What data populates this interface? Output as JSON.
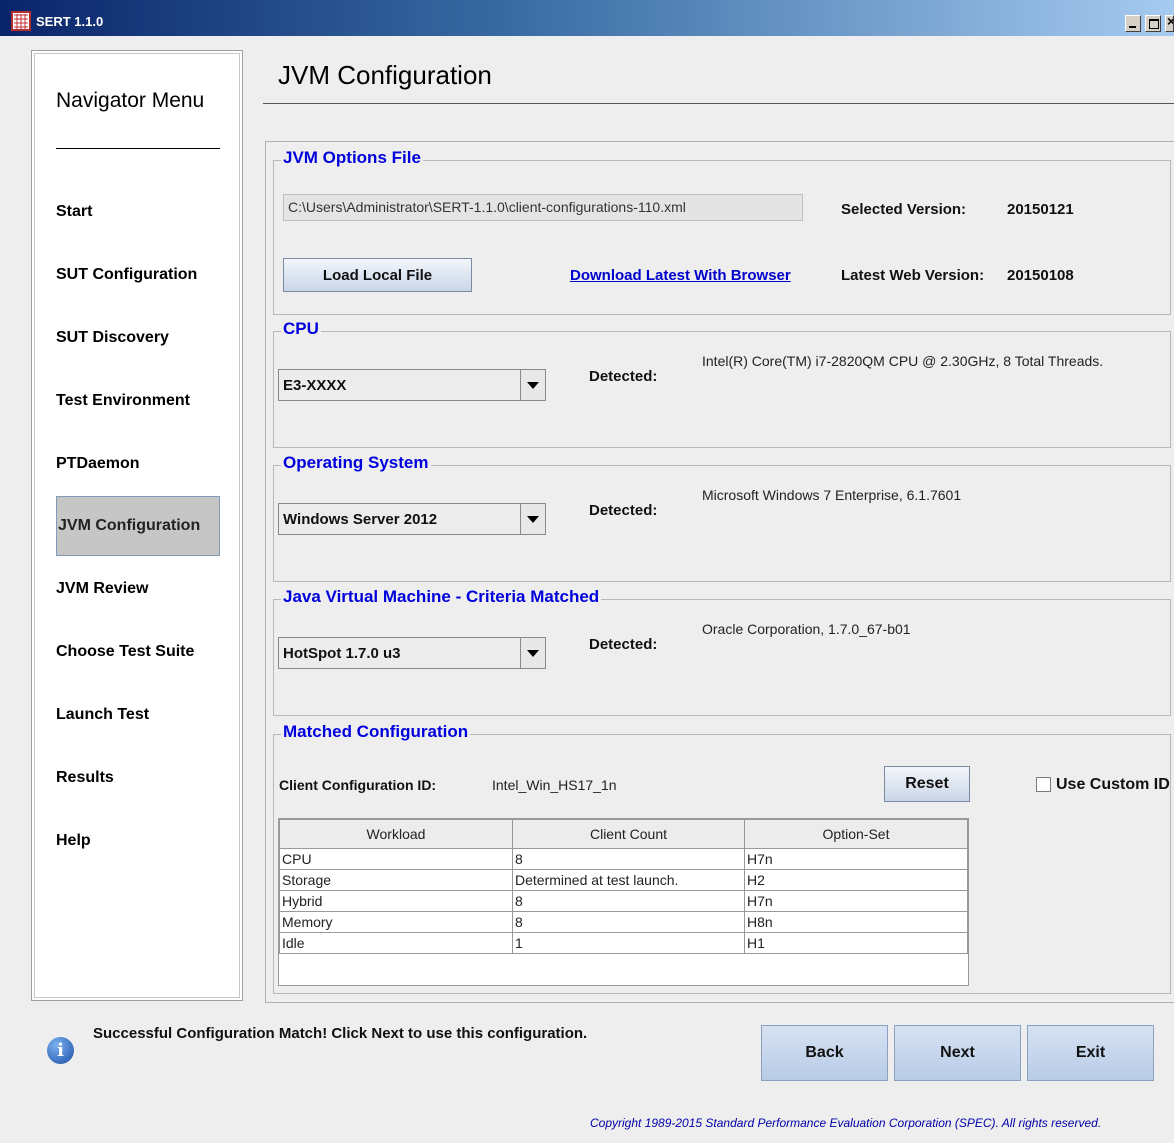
{
  "window": {
    "title": "SERT 1.1.0"
  },
  "nav": {
    "title": "Navigator Menu",
    "items": [
      {
        "label": "Start"
      },
      {
        "label": "SUT Configuration"
      },
      {
        "label": "SUT Discovery"
      },
      {
        "label": "Test Environment"
      },
      {
        "label": "PTDaemon"
      },
      {
        "label": "JVM Configuration",
        "active": true
      },
      {
        "label": "JVM Review"
      },
      {
        "label": "Choose Test Suite"
      },
      {
        "label": "Launch Test"
      },
      {
        "label": "Results"
      },
      {
        "label": "Help"
      }
    ]
  },
  "page": {
    "title": "JVM Configuration"
  },
  "options_file": {
    "title": "JVM Options File",
    "path": "C:\\Users\\Administrator\\SERT-1.1.0\\client-configurations-110.xml",
    "selected_version_label": "Selected Version:",
    "selected_version": "20150121",
    "load_button": "Load Local File",
    "download_link": "Download Latest With Browser",
    "latest_version_label": "Latest Web Version:",
    "latest_version": "20150108"
  },
  "cpu": {
    "title": "CPU",
    "selected": "E3-XXXX",
    "detected_label": "Detected:",
    "detected": "Intel(R) Core(TM) i7-2820QM CPU @ 2.30GHz, 8 Total Threads."
  },
  "os": {
    "title": "Operating System",
    "selected": "Windows Server 2012",
    "detected_label": "Detected:",
    "detected": "Microsoft Windows 7 Enterprise, 6.1.7601"
  },
  "jvm": {
    "title": "Java Virtual Machine - Criteria Matched",
    "selected": "HotSpot 1.7.0 u3",
    "detected_label": "Detected:",
    "detected": "Oracle Corporation, 1.7.0_67-b01"
  },
  "matched": {
    "title": "Matched Configuration",
    "client_id_label": "Client Configuration ID:",
    "client_id": "Intel_Win_HS17_1n",
    "reset_button": "Reset",
    "custom_id_label": "Use Custom ID",
    "custom_id_checked": false,
    "table": {
      "columns": [
        "Workload",
        "Client Count",
        "Option-Set"
      ],
      "rows": [
        [
          "CPU",
          "8",
          "H7n"
        ],
        [
          "Storage",
          "Determined at test launch.",
          "H2"
        ],
        [
          "Hybrid",
          "8",
          "H7n"
        ],
        [
          "Memory",
          "8",
          "H8n"
        ],
        [
          "Idle",
          "1",
          "H1"
        ]
      ]
    }
  },
  "status": {
    "message": "Successful Configuration Match! Click Next to use this configuration.",
    "icon": "info-icon"
  },
  "buttons": {
    "back": "Back",
    "next": "Next",
    "exit": "Exit"
  },
  "copyright": "Copyright 1989-2015 Standard Performance Evaluation Corporation (SPEC). All rights reserved."
}
